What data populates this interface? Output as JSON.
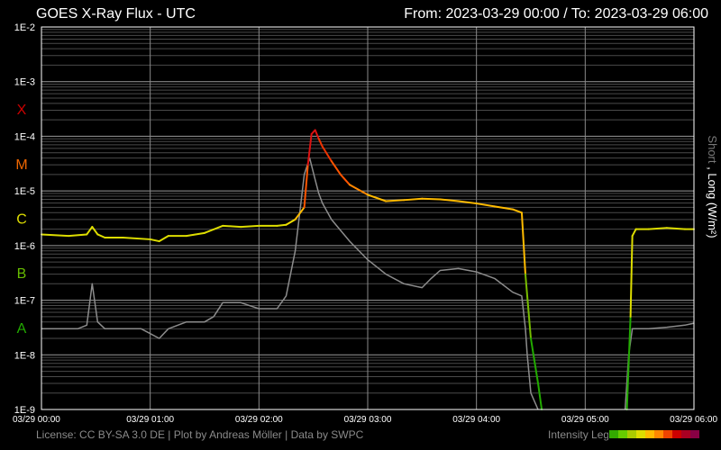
{
  "header": {
    "title": "GOES X-Ray Flux - UTC",
    "range": "From: 2023-03-29 00:00  /  To: 2023-03-29 06:00"
  },
  "footer": {
    "license": "License: CC BY-SA 3.0 DE | Plot by Andreas Möller | Data by SWPC",
    "legend_label": "Intensity Legend",
    "legend_colors": [
      "#33aa00",
      "#66cc00",
      "#aacc00",
      "#dddd00",
      "#ffbb00",
      "#ff8800",
      "#ee4400",
      "#cc0000",
      "#aa0022",
      "#880044"
    ]
  },
  "chart_data": {
    "type": "line",
    "title": "GOES X-Ray Flux - UTC",
    "ylabel_parts": [
      "Short",
      " , ",
      "Long (W/m²)"
    ],
    "y_scale": "log",
    "ylim": [
      1e-09,
      0.01
    ],
    "xlim": [
      "2023-03-29 00:00",
      "2023-03-29 06:00"
    ],
    "y_ticks": [
      {
        "value": 0.01,
        "label": "1E-2"
      },
      {
        "value": 0.001,
        "label": "1E-3"
      },
      {
        "value": 0.0001,
        "label": "1E-4"
      },
      {
        "value": 1e-05,
        "label": "1E-5"
      },
      {
        "value": 1e-06,
        "label": "1E-6"
      },
      {
        "value": 1e-07,
        "label": "1E-7"
      },
      {
        "value": 1e-08,
        "label": "1E-8"
      },
      {
        "value": 1e-09,
        "label": "1E-9"
      }
    ],
    "x_ticks": [
      {
        "value": "2023-03-29 00:00",
        "label": "03/29 00:00"
      },
      {
        "value": "2023-03-29 01:00",
        "label": "03/29 01:00"
      },
      {
        "value": "2023-03-29 02:00",
        "label": "03/29 02:00"
      },
      {
        "value": "2023-03-29 03:00",
        "label": "03/29 03:00"
      },
      {
        "value": "2023-03-29 04:00",
        "label": "03/29 04:00"
      },
      {
        "value": "2023-03-29 05:00",
        "label": "03/29 05:00"
      },
      {
        "value": "2023-03-29 06:00",
        "label": "03/29 06:00"
      }
    ],
    "flare_classes": [
      {
        "label": "X",
        "min": 0.0001,
        "color": "#cc0000"
      },
      {
        "label": "M",
        "min": 1e-05,
        "color": "#ee6600"
      },
      {
        "label": "C",
        "min": 1e-06,
        "color": "#dddd00"
      },
      {
        "label": "B",
        "min": 1e-07,
        "color": "#66bb00"
      },
      {
        "label": "A",
        "min": 1e-08,
        "color": "#22aa00"
      }
    ],
    "grid": true,
    "series": [
      {
        "name": "Long (W/m²)",
        "color_mode": "flare-class",
        "x": [
          "2023-03-29 00:00",
          "2023-03-29 00:15",
          "2023-03-29 00:25",
          "2023-03-29 00:28",
          "2023-03-29 00:31",
          "2023-03-29 00:35",
          "2023-03-29 00:45",
          "2023-03-29 01:00",
          "2023-03-29 01:05",
          "2023-03-29 01:10",
          "2023-03-29 01:20",
          "2023-03-29 01:30",
          "2023-03-29 01:40",
          "2023-03-29 01:50",
          "2023-03-29 02:00",
          "2023-03-29 02:10",
          "2023-03-29 02:15",
          "2023-03-29 02:20",
          "2023-03-29 02:25",
          "2023-03-29 02:27",
          "2023-03-29 02:29",
          "2023-03-29 02:31",
          "2023-03-29 02:33",
          "2023-03-29 02:35",
          "2023-03-29 02:40",
          "2023-03-29 02:45",
          "2023-03-29 02:50",
          "2023-03-29 03:00",
          "2023-03-29 03:10",
          "2023-03-29 03:20",
          "2023-03-29 03:30",
          "2023-03-29 03:40",
          "2023-03-29 03:50",
          "2023-03-29 04:00",
          "2023-03-29 04:10",
          "2023-03-29 04:20",
          "2023-03-29 04:25",
          "2023-03-29 04:27",
          "2023-03-29 04:30",
          "2023-03-29 04:34",
          "2023-03-29 04:36"
        ],
        "y": [
          1.6e-06,
          1.5e-06,
          1.6e-06,
          2.2e-06,
          1.6e-06,
          1.4e-06,
          1.4e-06,
          1.3e-06,
          1.2e-06,
          1.5e-06,
          1.5e-06,
          1.7e-06,
          2.3e-06,
          2.2e-06,
          2.3e-06,
          2.3e-06,
          2.4e-06,
          3e-06,
          5e-06,
          3e-05,
          0.00011,
          0.00013,
          9e-05,
          6.5e-05,
          3.5e-05,
          2e-05,
          1.3e-05,
          8.5e-06,
          6.5e-06,
          6.8e-06,
          7.2e-06,
          7e-06,
          6.5e-06,
          5.9e-06,
          5.2e-06,
          4.6e-06,
          4e-06,
          3e-07,
          2e-08,
          3e-09,
          1e-09
        ]
      },
      {
        "name": "Long (W/m²)",
        "color_mode": "flare-class",
        "x": [
          "2023-03-29 05:23",
          "2023-03-29 05:25",
          "2023-03-29 05:26",
          "2023-03-29 05:28",
          "2023-03-29 05:35",
          "2023-03-29 05:45",
          "2023-03-29 05:55",
          "2023-03-29 06:00"
        ],
        "y": [
          1e-09,
          5e-08,
          1.5e-06,
          2e-06,
          2e-06,
          2.1e-06,
          2e-06,
          2e-06
        ]
      },
      {
        "name": "Short",
        "color": "#8c8c8c",
        "x": [
          "2023-03-29 00:00",
          "2023-03-29 00:10",
          "2023-03-29 00:20",
          "2023-03-29 00:25",
          "2023-03-29 00:28",
          "2023-03-29 00:31",
          "2023-03-29 00:35",
          "2023-03-29 00:45",
          "2023-03-29 00:55",
          "2023-03-29 01:05",
          "2023-03-29 01:10",
          "2023-03-29 01:20",
          "2023-03-29 01:30",
          "2023-03-29 01:35",
          "2023-03-29 01:40",
          "2023-03-29 01:50",
          "2023-03-29 02:00",
          "2023-03-29 02:10",
          "2023-03-29 02:15",
          "2023-03-29 02:20",
          "2023-03-29 02:25",
          "2023-03-29 02:28",
          "2023-03-29 02:31",
          "2023-03-29 02:33",
          "2023-03-29 02:35",
          "2023-03-29 02:40",
          "2023-03-29 02:50",
          "2023-03-29 03:00",
          "2023-03-29 03:10",
          "2023-03-29 03:20",
          "2023-03-29 03:30",
          "2023-03-29 03:35",
          "2023-03-29 03:40",
          "2023-03-29 03:50",
          "2023-03-29 04:00",
          "2023-03-29 04:10",
          "2023-03-29 04:20",
          "2023-03-29 04:25",
          "2023-03-29 04:27",
          "2023-03-29 04:28",
          "2023-03-29 04:30",
          "2023-03-29 04:34"
        ],
        "y": [
          3e-08,
          3e-08,
          3e-08,
          3.5e-08,
          2e-07,
          4e-08,
          3e-08,
          3e-08,
          3e-08,
          2e-08,
          3e-08,
          4e-08,
          4e-08,
          5e-08,
          9e-08,
          9e-08,
          7e-08,
          7e-08,
          1.2e-07,
          8e-07,
          2e-05,
          4e-05,
          1.6e-05,
          9e-06,
          6e-06,
          3e-06,
          1.2e-06,
          5.5e-07,
          3e-07,
          2e-07,
          1.7e-07,
          2.5e-07,
          3.5e-07,
          3.8e-07,
          3.3e-07,
          2.5e-07,
          1.4e-07,
          1.2e-07,
          3e-08,
          1e-08,
          2e-09,
          1e-09
        ]
      },
      {
        "name": "Short",
        "color": "#8c8c8c",
        "x": [
          "2023-03-29 05:22",
          "2023-03-29 05:24",
          "2023-03-29 05:26",
          "2023-03-29 05:35",
          "2023-03-29 05:45",
          "2023-03-29 05:55",
          "2023-03-29 06:00"
        ],
        "y": [
          1e-09,
          1e-08,
          3e-08,
          3e-08,
          3.2e-08,
          3.5e-08,
          3.8e-08
        ]
      }
    ]
  }
}
